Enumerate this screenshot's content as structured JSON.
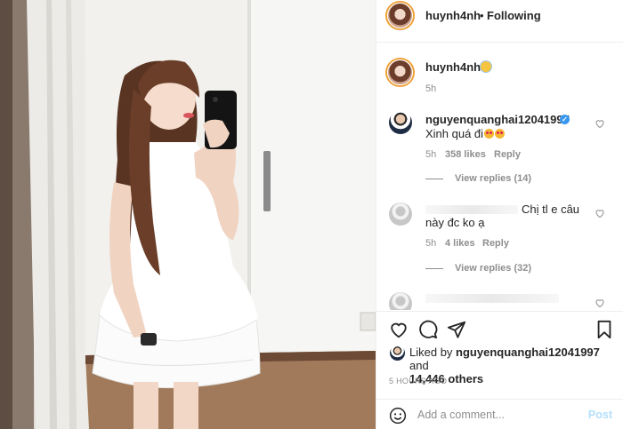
{
  "post": {
    "username": "huynh4nh",
    "follow_separator": "•",
    "follow_status": "Following",
    "caption_emoji": "smiling-face-with-halo",
    "caption_time": "5h"
  },
  "comments": [
    {
      "username": "nguyenquanghai12041997",
      "verified": true,
      "text": "Xinh quá đi",
      "emojis": [
        "heart-eyes-emoji",
        "kissing-heart-emoji"
      ],
      "time": "5h",
      "likes": "358 likes",
      "reply_label": "Reply",
      "view_replies": "View replies (14)"
    },
    {
      "username": "",
      "text_line1": "Chị tl e câu",
      "text_line2": "này đc ko ạ",
      "time": "5h",
      "likes": "4 likes",
      "reply_label": "Reply",
      "view_replies": "View replies (32)"
    }
  ],
  "actions": {
    "like_icon": "heart-outline-icon",
    "comment_icon": "comment-bubble-icon",
    "share_icon": "paper-plane-icon",
    "save_icon": "bookmark-icon"
  },
  "likes": {
    "prefix": "Liked by",
    "user": "nguyenquanghai12041997",
    "middle": "and",
    "count": "14,446 others"
  },
  "timestamp": "5 HOURS AGO",
  "add_comment": {
    "placeholder": "Add a comment...",
    "post_label": "Post"
  },
  "colors": {
    "text": "#262626",
    "secondary": "#8e8e8e",
    "verified": "#3897f0",
    "post_disabled": "#b2dffc",
    "border": "#efefef"
  }
}
